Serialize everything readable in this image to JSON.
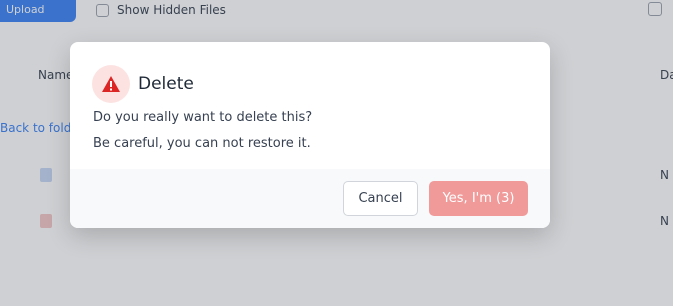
{
  "background": {
    "upload_button_label": "Upload",
    "show_hidden_label": "Show Hidden Files",
    "table_header_name": "Name",
    "table_header_right": "Da",
    "back_link": "Back to folder",
    "rows": [
      {
        "icon": "folder-icon",
        "name": "",
        "right": "N"
      },
      {
        "icon": "file-icon",
        "name": "",
        "right": "N"
      }
    ]
  },
  "dialog": {
    "icon": "warning-icon",
    "title": "Delete",
    "message_line1": "Do you really want to delete this?",
    "message_line2": "Be careful, you can not restore it.",
    "cancel_label": "Cancel",
    "confirm_label": "Yes, I'm (3)"
  },
  "colors": {
    "primary": "#3b82f6",
    "danger_disabled": "#f09a9a",
    "danger_icon": "#dc2626",
    "icon_bg": "#fde2e2"
  }
}
